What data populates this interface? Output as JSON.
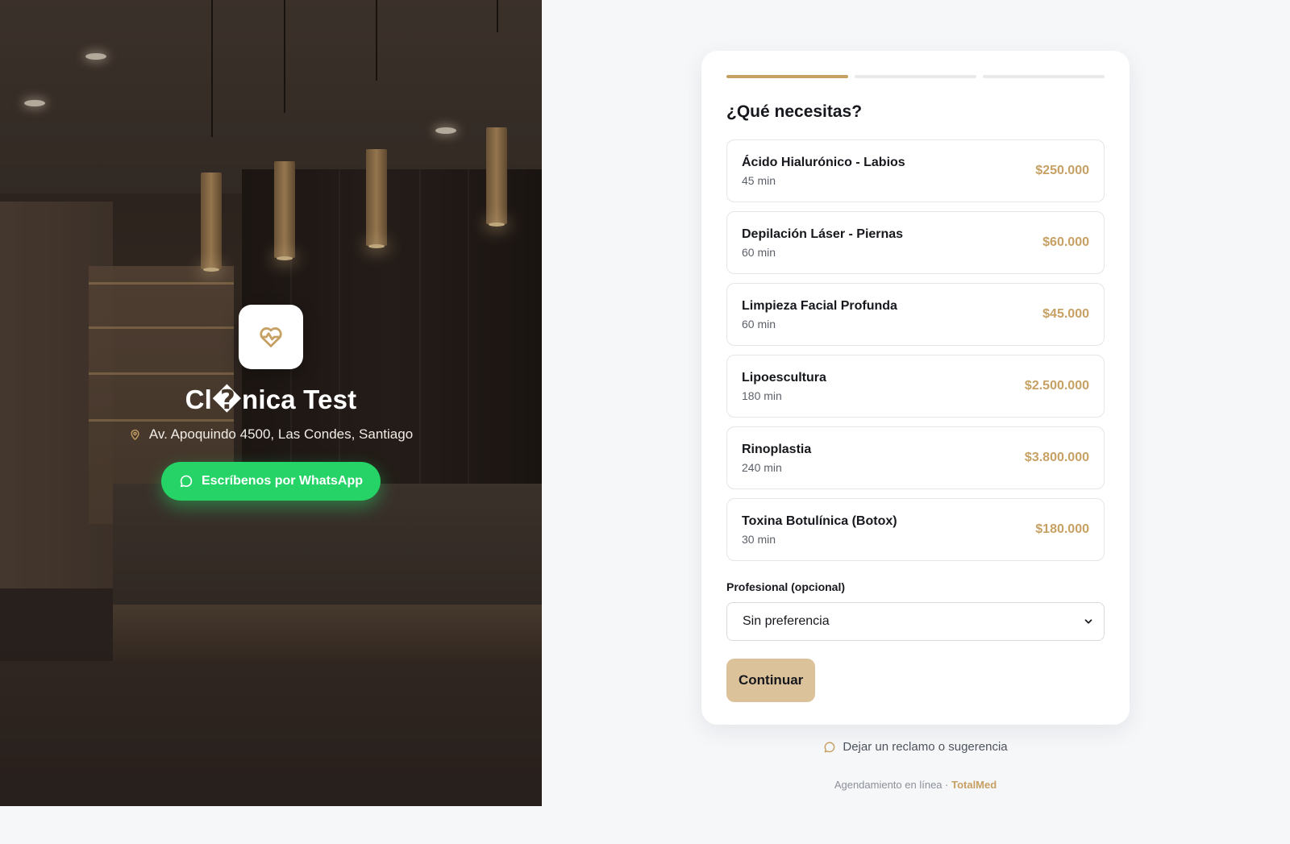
{
  "clinic": {
    "name": "Cl�nica Test",
    "address": "Av. Apoquindo 4500, Las Condes, Santiago",
    "whatsapp_label": "Escríbenos por WhatsApp",
    "logo_icon": "heart-pulse-icon",
    "address_icon": "map-pin-icon"
  },
  "progress": {
    "current_step": 1,
    "total_steps": 3
  },
  "booking": {
    "title": "¿Qué necesitas?",
    "services": [
      {
        "name": "Ácido Hialurónico - Labios",
        "duration": "45 min",
        "price": "$250.000"
      },
      {
        "name": "Depilación Láser - Piernas",
        "duration": "60 min",
        "price": "$60.000"
      },
      {
        "name": "Limpieza Facial Profunda",
        "duration": "60 min",
        "price": "$45.000"
      },
      {
        "name": "Lipoescultura",
        "duration": "180 min",
        "price": "$2.500.000"
      },
      {
        "name": "Rinoplastia",
        "duration": "240 min",
        "price": "$3.800.000"
      },
      {
        "name": "Toxina Botulínica (Botox)",
        "duration": "30 min",
        "price": "$180.000"
      }
    ],
    "professional_label": "Profesional (opcional)",
    "professional_selected": "Sin preferencia",
    "continue_label": "Continuar"
  },
  "feedback_label": "Dejar un reclamo o sugerencia",
  "footer": {
    "text": "Agendamiento en línea · ",
    "brand": "TotalMed"
  },
  "colors": {
    "accent_gold": "#c7a063",
    "button_gold": "#dcc29a",
    "whatsapp_green": "#25d366",
    "page_bg": "#f6f7f9"
  }
}
